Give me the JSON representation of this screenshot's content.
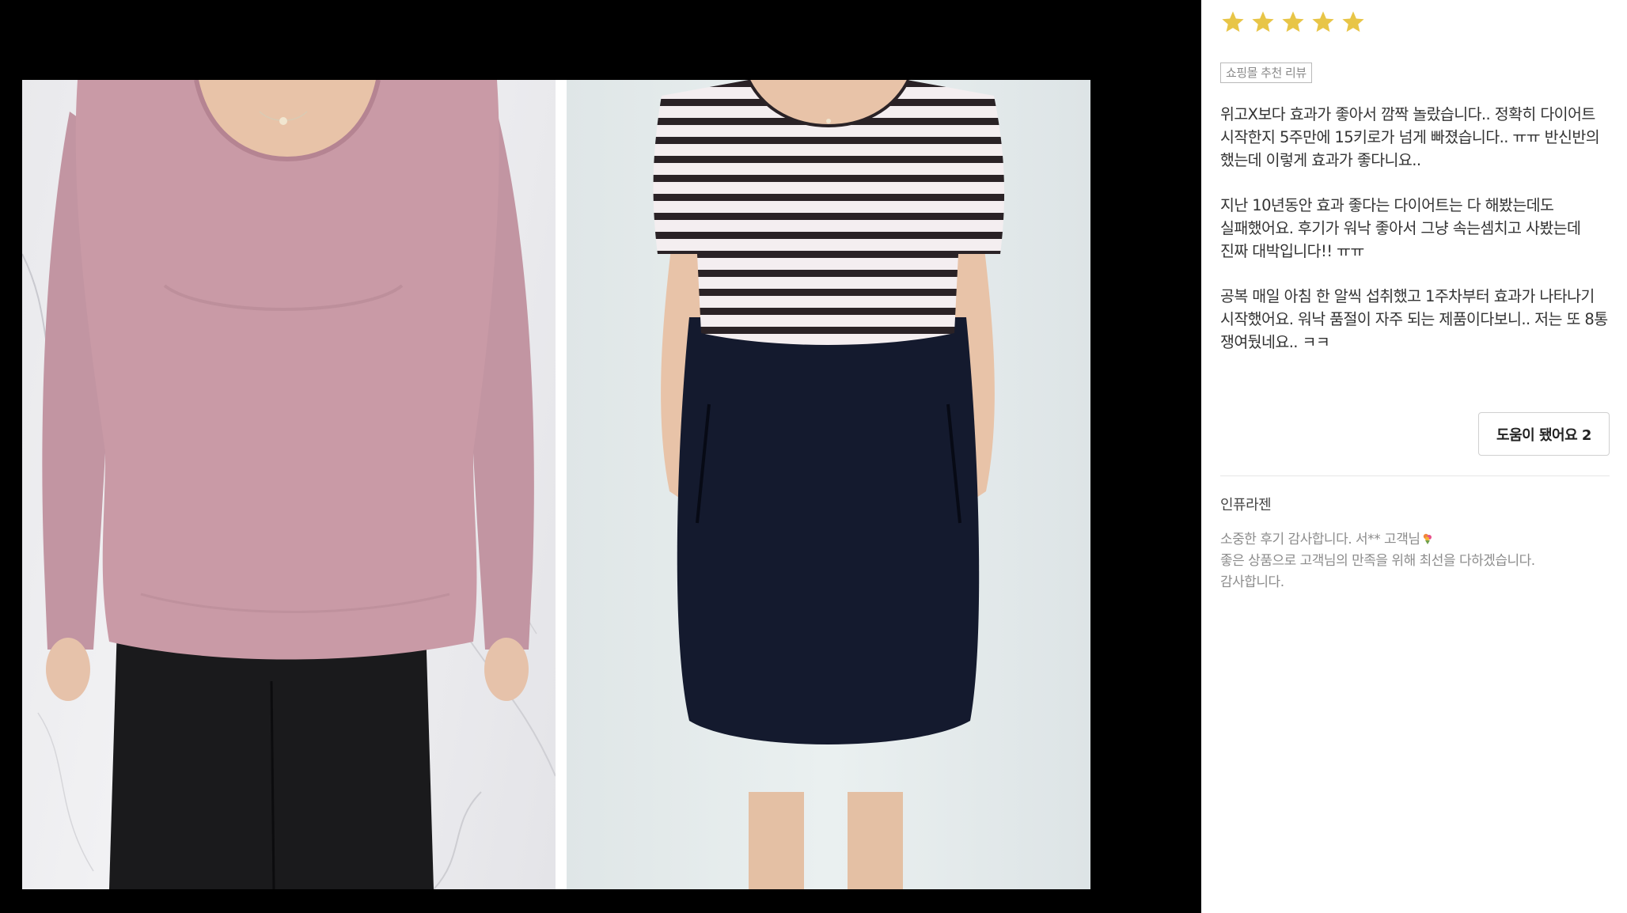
{
  "review": {
    "rating": 5,
    "rating_max": 5,
    "badge": "쇼핑몰 추천 리뷰",
    "paragraphs": [
      "위고X보다 효과가 좋아서 깜짝 놀랐습니다.. 정확히 다이어트 시작한지 5주만에 15키로가 넘게 빠졌습니다.. ㅠㅠ 반신반의 했는데 이렇게 효과가 좋다니요..",
      "지난 10년동안 효과 좋다는 다이어트는 다 해봤는데도 실패했어요. 후기가 워낙 좋아서 그냥 속는셈치고 사봤는데 진짜 대박입니다!! ㅠㅠ",
      "공복 매일 아침 한 알씩 섭취했고 1주차부터 효과가 나타나기 시작했어요. 워낙 품절이 자주 되는 제품이다보니.. 저는 또 8통 쟁여뒀네요.. ㅋㅋ"
    ],
    "helpful_label": "도움이 됐어요 2"
  },
  "seller": {
    "name": "인퓨라젠",
    "reply_lines": [
      "소중한 후기 감사합니다. 서** 고객님",
      "좋은 상품으로 고객님의 만족을 위해 최선을 다하겠습니다.",
      "감사합니다."
    ],
    "reply_icon": "bouquet-icon"
  },
  "photo": {
    "icon": "before-after-photo",
    "before_top": "pink long-sleeve top",
    "before_bottom": "black pants",
    "after_top": "white with black stripes short-sleeve top",
    "after_bottom": "navy skirt"
  },
  "colors": {
    "star": "#e8c547",
    "pink_top": "#c99aa6",
    "black_pants": "#1a1a1c",
    "stripe": "#2a2226",
    "navy_skirt": "#141a2e",
    "skin": "#e8c3a8"
  }
}
